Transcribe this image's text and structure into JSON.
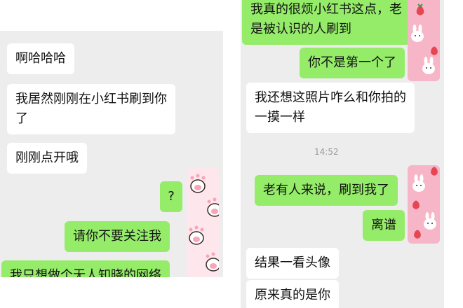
{
  "left_chat": {
    "messages": [
      {
        "text": "啊哈哈哈"
      },
      {
        "text": "我居然刚刚在小红书刷到你",
        "text2": "了"
      },
      {
        "text": "刚刚点开哦"
      },
      {
        "text": "?"
      },
      {
        "text": "请你不要关注我"
      },
      {
        "text": "我只想做个无人知晓的网络"
      }
    ]
  },
  "right_chat": {
    "timestamp": "14:52",
    "messages": [
      {
        "text": "我真的很烦小红书这点，老",
        "text2": "是被认识的人刷到"
      },
      {
        "text": "你不是第一个了"
      },
      {
        "text": "我还想这照片咋么和你拍的",
        "text2": "一摸一样"
      },
      {
        "text": "老有人来说，刷到我了"
      },
      {
        "text": "离谱"
      },
      {
        "text": "结果一看头像"
      },
      {
        "text": "原来真的是你"
      }
    ]
  },
  "colors": {
    "chat_bg": "#ededed",
    "incoming": "#ffffff",
    "outgoing": "#95ec69"
  },
  "icons": {
    "left_avatar": "bear-paw-avatar",
    "right_avatar": "bunny-strawberry-avatar"
  }
}
